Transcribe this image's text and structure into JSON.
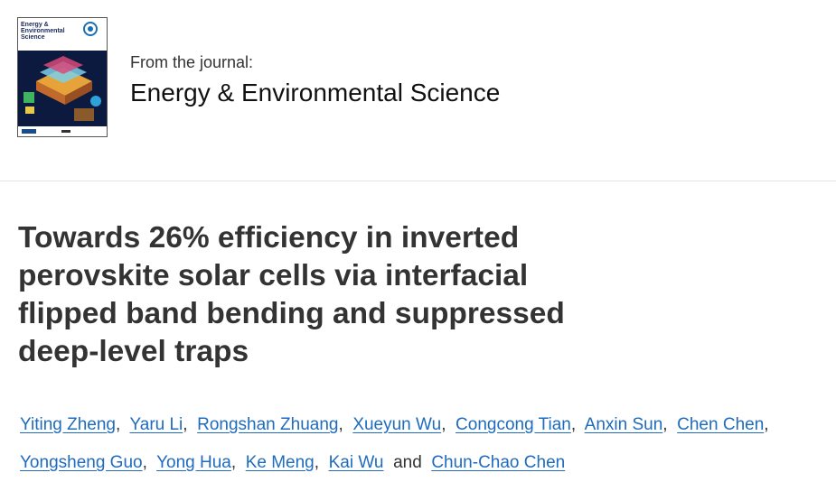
{
  "journal": {
    "cover_title_lines": [
      "Energy &",
      "Environmental",
      "Science"
    ],
    "from_label": "From the journal:",
    "name": "Energy & Environmental Science"
  },
  "article": {
    "title_lines": [
      "Towards 26% efficiency in inverted",
      "perovskite solar cells via interfacial",
      "flipped band bending and suppressed",
      "deep-level traps"
    ]
  },
  "authors": [
    "Yiting Zheng",
    "Yaru Li",
    "Rongshan Zhuang",
    "Xueyun Wu",
    "Congcong Tian",
    "Anxin Sun",
    "Chen Chen",
    "Yongsheng Guo",
    "Yong Hua",
    "Ke Meng",
    "Kai Wu",
    "Chun-Chao Chen"
  ],
  "author_separator": ",",
  "author_conjunction": "and",
  "colors": {
    "link": "#1f6bbd",
    "text": "#333333",
    "divider": "#e3e3e3"
  }
}
